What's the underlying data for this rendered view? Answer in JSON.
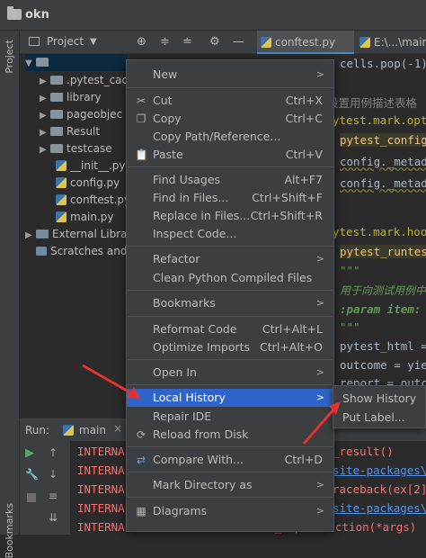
{
  "window": {
    "title": "okn"
  },
  "left_strip": {
    "project_label": "Project",
    "bookmarks_label": "Bookmarks"
  },
  "project_toolbar": {
    "label": "Project"
  },
  "tree": {
    "root": "",
    "items": [
      {
        "label": ".pytest_cac",
        "type": "folder"
      },
      {
        "label": "library",
        "type": "folder"
      },
      {
        "label": "pageobjec",
        "type": "folder"
      },
      {
        "label": "Result",
        "type": "folder"
      },
      {
        "label": "testcase",
        "type": "folder"
      },
      {
        "label": "__init__.py",
        "type": "py"
      },
      {
        "label": "config.py",
        "type": "py"
      },
      {
        "label": "conftest.py",
        "type": "py"
      },
      {
        "label": "main.py",
        "type": "py"
      },
      {
        "label": "External Librar",
        "type": "lib"
      },
      {
        "label": "Scratches and",
        "type": "scratch"
      }
    ]
  },
  "editor_tabs": [
    {
      "label": "conftest.py",
      "active": true
    },
    {
      "label": "E:\\...\\main."
    }
  ],
  "editor": {
    "lines": [
      "cells.pop(-1)",
      "设置用例描述表格",
      "ytest.mark.opti",
      "pytest_config",
      "config._metad",
      "config._metad",
      "ytest.mark.hook",
      "pytest_runtes",
      "\"\"\"",
      "用于向测试用例中",
      ":param item:",
      "\"\"\"",
      "pytest_html =",
      "outcome = yie",
      "report = outc"
    ]
  },
  "run": {
    "label": "Run:",
    "config": "main",
    "console_lines": [
      {
        "left": "INTERNA",
        "right": "_result()",
        "right_type": "err"
      },
      {
        "left": "INTERNA",
        "right": "site-packages\\",
        "right_type": "link"
      },
      {
        "left": "INTERNA",
        "right": "raceback(ex[2]",
        "right_type": "err"
      },
      {
        "left": "INTERNA",
        "right": "site-packages\\",
        "right_type": "link"
      },
      {
        "left": "INTERNALERROR>",
        "right": "res = hook_impl.function(*args)",
        "right_type": "err"
      }
    ]
  },
  "context_menu": {
    "items": [
      {
        "label": "New",
        "submenu": true
      },
      {
        "sep": true
      },
      {
        "label": "Cut",
        "shortcut": "Ctrl+X",
        "icon": "scissors-icon"
      },
      {
        "label": "Copy",
        "shortcut": "Ctrl+C",
        "icon": "copy-icon"
      },
      {
        "label": "Copy Path/Reference..."
      },
      {
        "label": "Paste",
        "shortcut": "Ctrl+V",
        "icon": "paste-icon"
      },
      {
        "sep": true
      },
      {
        "label": "Find Usages",
        "shortcut": "Alt+F7"
      },
      {
        "label": "Find in Files...",
        "shortcut": "Ctrl+Shift+F"
      },
      {
        "label": "Replace in Files...",
        "shortcut": "Ctrl+Shift+R"
      },
      {
        "label": "Inspect Code..."
      },
      {
        "sep": true
      },
      {
        "label": "Refactor",
        "submenu": true
      },
      {
        "label": "Clean Python Compiled Files"
      },
      {
        "sep": true
      },
      {
        "label": "Bookmarks",
        "submenu": true
      },
      {
        "sep": true
      },
      {
        "label": "Reformat Code",
        "shortcut": "Ctrl+Alt+L"
      },
      {
        "label": "Optimize Imports",
        "shortcut": "Ctrl+Alt+O"
      },
      {
        "sep": true
      },
      {
        "label": "Open In",
        "submenu": true
      },
      {
        "sep": true
      },
      {
        "label": "Local History",
        "submenu": true,
        "selected": true
      },
      {
        "label": "Repair IDE"
      },
      {
        "label": "Reload from Disk",
        "icon": "reload-icon"
      },
      {
        "sep": true
      },
      {
        "label": "Compare With...",
        "shortcut": "Ctrl+D",
        "icon": "compare-icon"
      },
      {
        "sep": true
      },
      {
        "label": "Mark Directory as",
        "submenu": true
      },
      {
        "sep": true
      },
      {
        "label": "Diagrams",
        "submenu": true,
        "icon": "diagram-icon"
      }
    ]
  },
  "submenu": {
    "items": [
      "Show History",
      "Put Label..."
    ]
  },
  "colors": {
    "accent": "#2f65ca",
    "arrow": "#e0332f"
  }
}
